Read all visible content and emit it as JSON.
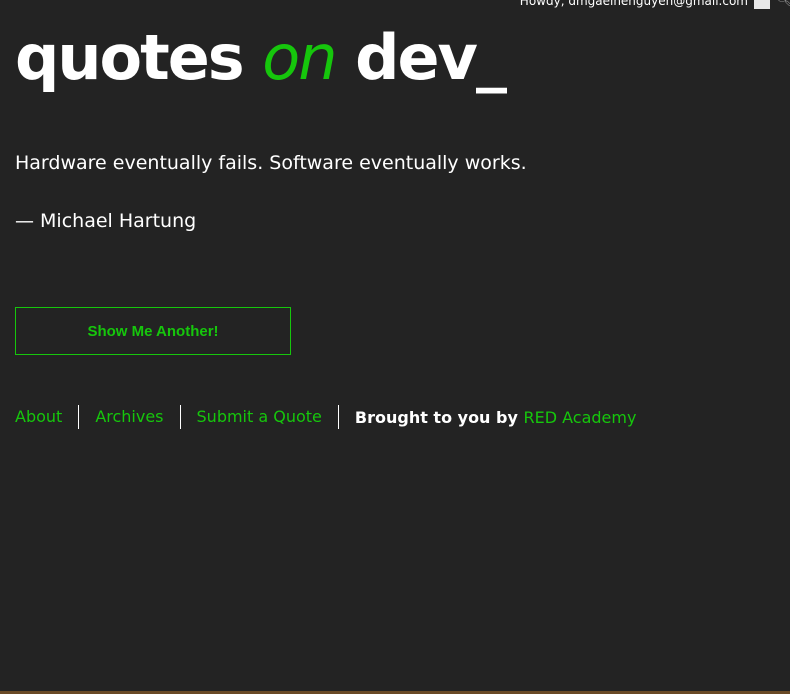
{
  "admin_bar": {
    "greeting": "Howdy, dmgaeinenguyen@gmail.com",
    "avatar_icon": "avatar-icon",
    "search_icon": "search-icon"
  },
  "header": {
    "logo_part1": "quotes ",
    "logo_part2": "on",
    "logo_part3": " dev_"
  },
  "quote": {
    "text": "Hardware eventually fails. Software eventually works.",
    "author": "— Michael Hartung"
  },
  "actions": {
    "show_another_label": "Show Me Another!"
  },
  "footer": {
    "links": [
      {
        "label": "About"
      },
      {
        "label": "Archives"
      },
      {
        "label": "Submit a Quote"
      }
    ],
    "credit_prefix": "Brought to you by ",
    "credit_link": "RED Academy"
  },
  "colors": {
    "accent": "#16c60c",
    "background": "#232323",
    "text": "#ffffff"
  }
}
